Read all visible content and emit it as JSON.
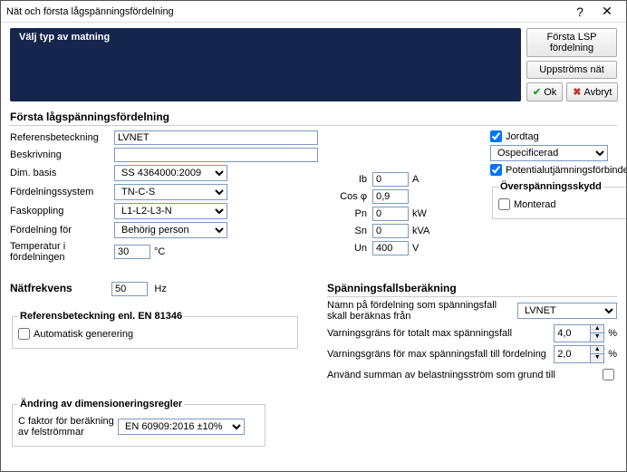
{
  "window": {
    "title": "Nät och första lågspänningsfördelning"
  },
  "modebar": {
    "label": "Välj typ av matning"
  },
  "buttons": {
    "first_lsp": "Första LSP fördelning",
    "upstream": "Uppströms nät",
    "ok": "Ok",
    "cancel": "Avbryt"
  },
  "lv": {
    "heading": "Första lågspänningsfördelning",
    "ref_label": "Referensbeteckning",
    "ref_value": "LVNET",
    "desc_label": "Beskrivning",
    "desc_value": "",
    "dimbasis_label": "Dim. basis",
    "dimbasis_value": "SS 4364000:2009",
    "distsys_label": "Fördelningssystem",
    "distsys_value": "TN-C-S",
    "phase_label": "Faskoppling",
    "phase_value": "L1-L2-L3-N",
    "distfor_label": "Fördelning för",
    "distfor_value": "Behörig person",
    "temp_label": "Temperatur i fördelningen",
    "temp_value": "30",
    "temp_unit": "°C"
  },
  "elec": {
    "Ib_label": "Ib",
    "Ib_value": "0",
    "Ib_unit": "A",
    "cos_label": "Cos φ",
    "cos_value": "0,9",
    "Pn_label": "Pn",
    "Pn_value": "0",
    "Pn_unit": "kW",
    "Sn_label": "Sn",
    "Sn_value": "0",
    "Sn_unit": "kVA",
    "Un_label": "Un",
    "Un_value": "400",
    "Un_unit": "V"
  },
  "earth": {
    "label": "Jordtag",
    "value": "Ospecificerad",
    "equi_label": "Potentialutjämningsförbindelse."
  },
  "surge": {
    "legend": "Överspänningsskydd",
    "mounted_label": "Monterad"
  },
  "freq": {
    "heading": "Nätfrekvens",
    "value": "50",
    "unit": "Hz"
  },
  "ref81346": {
    "heading": "Referensbeteckning enl. EN 81346",
    "auto_label": "Automatisk generering"
  },
  "vdrop": {
    "heading": "Spänningsfallsberäkning",
    "name_label": "Namn på fördelning som spänningsfall skall beräknas från",
    "name_value": "LVNET",
    "total_label": "Varningsgräns för totalt max spänningsfall",
    "total_value": "4,0",
    "part_label": "Varningsgräns för max spänningsfall till fördelning",
    "part_value": "2,0",
    "pct": "%",
    "usebase_label": "Använd summan av belastningsström som grund till"
  },
  "dimrule": {
    "heading": "Ändring av dimensioneringsregler",
    "c_label": "C faktor för beräkning av felströmmar",
    "c_value": "EN 60909:2016 ±10%"
  }
}
